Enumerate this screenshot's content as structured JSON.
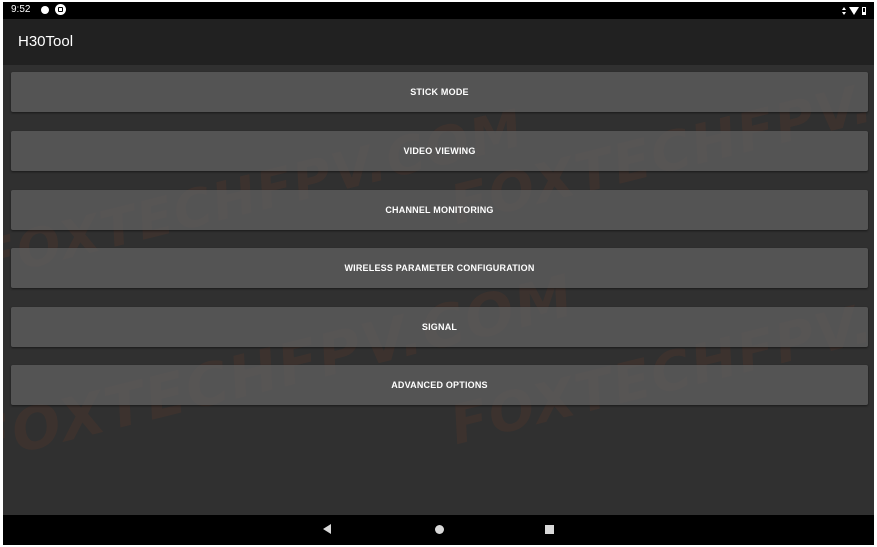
{
  "status_bar": {
    "time": "9:52",
    "icons": [
      "notification-dot-icon",
      "notification-icon",
      "data-arrows-icon",
      "wifi-icon",
      "battery-icon"
    ]
  },
  "app_bar": {
    "title": "H30Tool"
  },
  "menu": {
    "items": [
      {
        "label": "STICK MODE"
      },
      {
        "label": "VIDEO VIEWING"
      },
      {
        "label": "CHANNEL MONITORING"
      },
      {
        "label": "WIRELESS PARAMETER CONFIGURATION"
      },
      {
        "label": "SIGNAL"
      },
      {
        "label": "ADVANCED OPTIONS"
      }
    ]
  },
  "watermark": {
    "text": "FOXTECHFPV.COM"
  },
  "nav_bar": {
    "icons": [
      "back-icon",
      "home-icon",
      "recents-icon"
    ]
  },
  "colors": {
    "background": "#303030",
    "app_bar": "#212121",
    "button": "#5f5f5f",
    "status_bar": "#000000",
    "text": "#ffffff"
  }
}
